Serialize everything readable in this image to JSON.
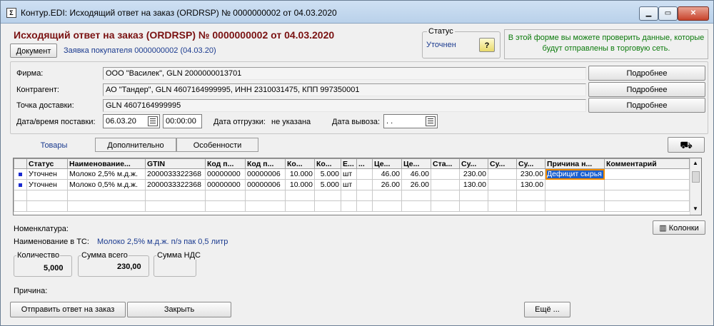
{
  "window": {
    "title": "Контур.EDI: Исходящий ответ на заказ (ORDRSP) № 0000000002 от 04.03.2020"
  },
  "header": {
    "doc_title": "Исходящий ответ на заказ (ORDRSP) № 0000000002 от 04.03.2020",
    "document_button": "Документ",
    "link_text": "Заявка покупателя 0000000002 (04.03.20)"
  },
  "status": {
    "legend": "Статус",
    "value": "Уточнен",
    "help_label": "?"
  },
  "info": {
    "text": "В этой форме вы можете проверить данные, которые будут отправлены в торговую сеть."
  },
  "form": {
    "firm_label": "Фирма:",
    "firm_value": "ООО \"Василек\", GLN 2000000013701",
    "counterparty_label": "Контрагент:",
    "counterparty_value": "АО \"Тандер\", GLN 4607164999995, ИНН 2310031475, КПП 997350001",
    "delivery_point_label": "Точка доставки:",
    "delivery_point_value": "GLN 4607164999995",
    "more_label": "Подробнее",
    "delivery_dt_label": "Дата/время поставки:",
    "delivery_date": "06.03.20",
    "delivery_time": "00:00:00",
    "ship_date_label": "Дата отгрузки:",
    "ship_date_value": "не указана",
    "pickup_date_label": "Дата вывоза:",
    "pickup_date_value": " .  ."
  },
  "tabs": [
    "Товары",
    "Дополнительно",
    "Особенности"
  ],
  "table": {
    "columns": [
      "Статус",
      "Наименование...",
      "GTIN",
      "Код п...",
      "Код п...",
      "Ко...",
      "Ко...",
      "Е...",
      "...",
      "Це...",
      "Це...",
      "Ста...",
      "Су...",
      "Су...",
      "Су...",
      "Причина н...",
      "Комментарий"
    ],
    "rows": [
      [
        "Уточнен",
        "Молоко 2,5% м.д.ж.",
        "2000033322368",
        "00000000",
        "00000006",
        "10.000",
        "5.000",
        "шт",
        "",
        "46.00",
        "46.00",
        "",
        "230.00",
        "",
        "230.00",
        "Дефицит сырья",
        ""
      ],
      [
        "Уточнен",
        "Молоко 0,5% м.д.ж.",
        "2000033322368",
        "00000000",
        "00000006",
        "10.000",
        "5.000",
        "шт",
        "",
        "26.00",
        "26.00",
        "",
        "130.00",
        "",
        "130.00",
        "",
        ""
      ]
    ]
  },
  "details": {
    "nomenclature_label": "Номенклатура:",
    "ts_name_label": "Наименование в ТС:",
    "ts_name_value": "Молоко 2,5% м.д.ж. п/э пак 0,5 литр",
    "columns_button": "Колонки"
  },
  "totals": {
    "qty_label": "Количество",
    "qty_value": "5,000",
    "sum_label": "Сумма всего",
    "sum_value": "230,00",
    "vat_label": "Сумма НДС",
    "vat_value": ""
  },
  "reason_label": "Причина:",
  "footer": {
    "send_button": "Отправить ответ на заказ",
    "close_button": "Закрыть",
    "more_button": "Ещё ..."
  },
  "colors": {
    "title": "#7a1212",
    "link": "#1a3a8f",
    "info": "#0b7a0b",
    "selection": "#1a5fd0",
    "highlight_border": "#f08a00"
  }
}
